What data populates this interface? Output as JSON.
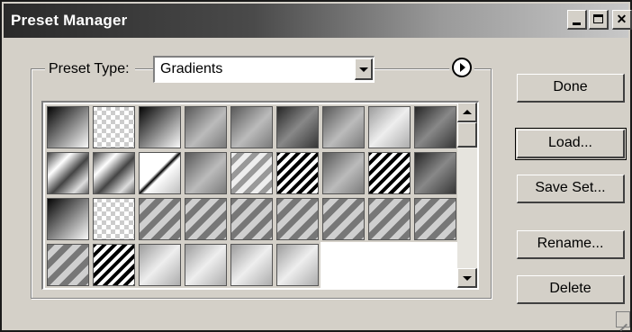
{
  "window": {
    "title": "Preset Manager",
    "controls": [
      "minimize",
      "maximize",
      "close"
    ]
  },
  "preset_type": {
    "label": "Preset Type:",
    "selected": "Gradients"
  },
  "buttons": {
    "done": "Done",
    "load": "Load...",
    "save_set": "Save Set...",
    "rename": "Rename...",
    "delete": "Delete"
  },
  "swatches": [
    "black-white",
    "transparent-checker",
    "black-white",
    "gray-diagonal",
    "gray-diagonal",
    "dark-gray-diagonal",
    "gray-diagonal",
    "light-gray-diagonal",
    "dark-gray-diagonal",
    "chrome",
    "chrome",
    "white-black-band",
    "gray-diagonal",
    "checker-stripes",
    "black-white-stripes",
    "gray-diagonal",
    "black-white-stripes",
    "dark-gray-diagonal",
    "black-white",
    "transparent-checker",
    "gray-stripes",
    "gray-stripes",
    "gray-stripes",
    "gray-stripes",
    "gray-stripes",
    "gray-stripes",
    "gray-stripes",
    "gray-stripes",
    "black-white-stripes",
    "light-gray-diagonal",
    "light-gray-diagonal",
    "light-gray-diagonal",
    "light-gray-diagonal"
  ],
  "colors": {
    "dialog_bg": "#d4d0c8",
    "titlebar_start": "#2a2a2a",
    "titlebar_end": "#c8c8c8"
  }
}
